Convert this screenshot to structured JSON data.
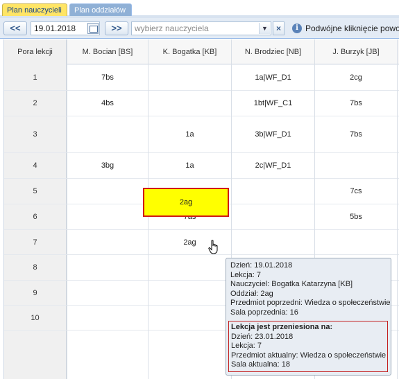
{
  "tabs": [
    {
      "label": "Plan nauczycieli",
      "active": true
    },
    {
      "label": "Plan oddziałów",
      "active": false
    }
  ],
  "toolbar": {
    "prev_label": "<<",
    "next_label": ">>",
    "date_value": "19.01.2018",
    "teacher_placeholder": "wybierz nauczyciela",
    "clear_label": "×",
    "info_label": "i",
    "hint_text": "Podwójne kliknięcie powo"
  },
  "grid": {
    "lesson_header": "Pora lekcji",
    "teachers": [
      "M. Bocian [BS]",
      "K. Bogatka [KB]",
      "N. Brodziec [NB]",
      "J. Burzyk [JB]"
    ],
    "rows": [
      {
        "lesson": "1",
        "cells": [
          "7bs",
          "",
          "1a|WF_D1",
          "2cg"
        ]
      },
      {
        "lesson": "2",
        "cells": [
          "4bs",
          "",
          "1bt|WF_C1",
          "7bs"
        ]
      },
      {
        "lesson": "3",
        "cells": [
          "",
          "1a",
          "3b|WF_D1",
          "7bs"
        ]
      },
      {
        "lesson": "4",
        "cells": [
          "3bg",
          "1a",
          "2c|WF_D1",
          ""
        ]
      },
      {
        "lesson": "5",
        "cells": [
          "",
          "",
          "",
          "7cs"
        ]
      },
      {
        "lesson": "6",
        "cells": [
          "",
          "7as",
          "",
          "5bs"
        ]
      },
      {
        "lesson": "7",
        "cells": [
          "",
          "2ag",
          "",
          ""
        ]
      },
      {
        "lesson": "8",
        "cells": [
          "",
          "",
          "",
          ""
        ]
      },
      {
        "lesson": "9",
        "cells": [
          "",
          "",
          "",
          ""
        ]
      },
      {
        "lesson": "10",
        "cells": [
          "",
          "",
          "",
          ""
        ]
      }
    ],
    "highlighted_cell_text": "2ag"
  },
  "tooltip": {
    "day": "Dzień: 19.01.2018",
    "lesson": "Lekcja: 7",
    "teacher": "Nauczyciel: Bogatka Katarzyna [KB]",
    "class": "Oddział: 2ag",
    "previous_subject": "Przedmiot poprzedni: Wiedza o społeczeństwie",
    "previous_room": "Sala poprzednia: 16",
    "moved_title": "Lekcja jest przeniesiona na:",
    "moved_day": "Dzień: 23.01.2018",
    "moved_lesson": "Lekcja: 7",
    "current_subject": "Przedmiot aktualny: Wiedza o społeczeństwie",
    "current_room": "Sala aktualna: 18"
  },
  "colors": {
    "active_tab": "#ffe566",
    "highlight_fill": "#ffff00",
    "highlight_border": "#d01818"
  }
}
